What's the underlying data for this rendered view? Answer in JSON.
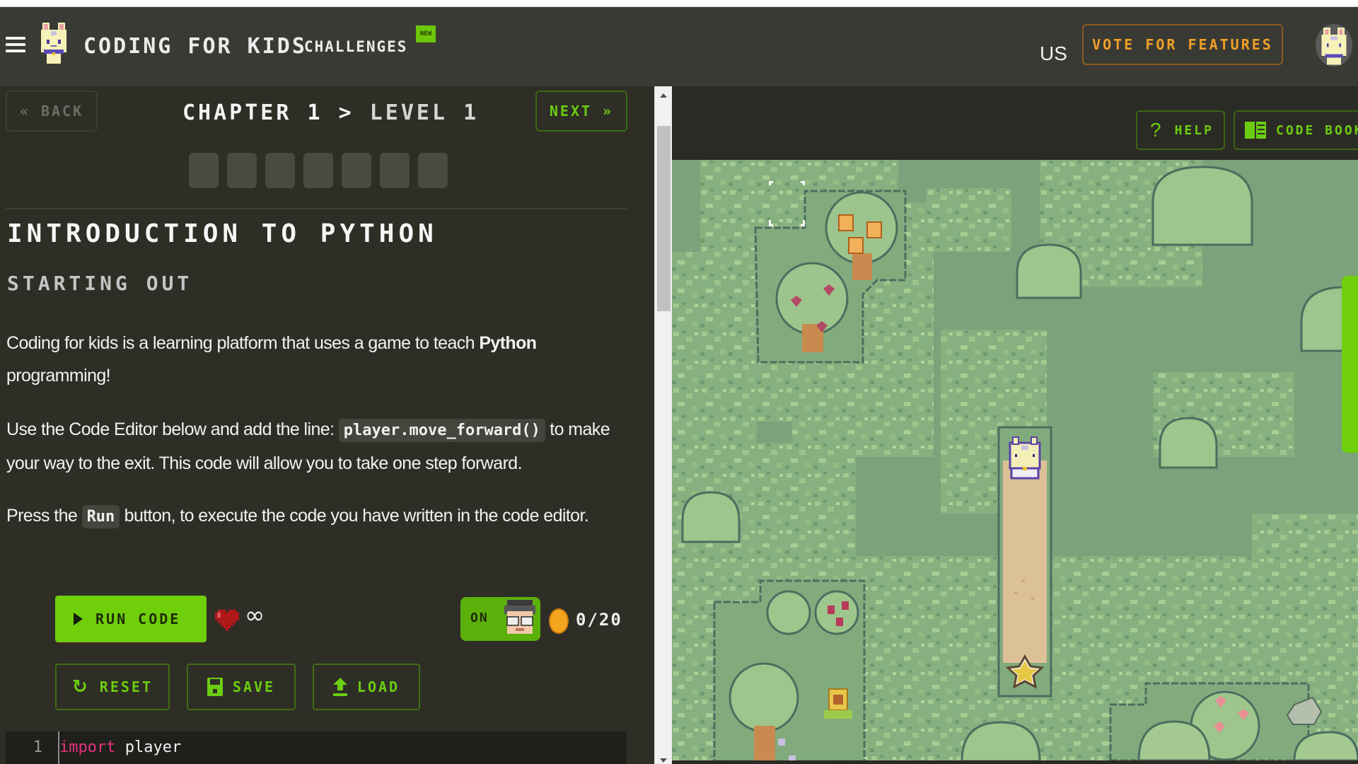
{
  "header": {
    "brand": "CODING FOR KIDS",
    "challenges_label": "CHALLENGES",
    "new_badge": "NEW",
    "locale": "US",
    "vote_label": "VOTE FOR FEATURES"
  },
  "lesson_nav": {
    "back_label": "« BACK",
    "chapter": "CHAPTER 1",
    "separator": ">",
    "level": "LEVEL 1",
    "next_label": "NEXT »",
    "progress_steps": 7,
    "progress_completed": 0
  },
  "lesson": {
    "title": "INTRODUCTION TO PYTHON",
    "subtitle": "STARTING OUT",
    "p1_text": "Coding for kids is a learning platform that uses a game to teach ",
    "p1_bold": "Python",
    "p1_end": " programming!",
    "p2_text": "Use the Code Editor below and add the line: ",
    "p2_code": "player.move_forward()",
    "p2_end": " to make your way to the exit. This code will allow you to take one step forward.",
    "p3_text": "Press the ",
    "p3_code": "Run",
    "p3_end": " button, to execute the code you have written in the code editor."
  },
  "controls": {
    "run_label": "RUN CODE",
    "lives": "∞",
    "toggle_label": "ON",
    "coins": "0/20",
    "reset_label": "RESET",
    "save_label": "SAVE",
    "load_label": "LOAD"
  },
  "editor": {
    "lines": [
      {
        "number": "1",
        "keyword": "import",
        "rest": " player"
      }
    ]
  },
  "game_toolbar": {
    "help_label": "HELP",
    "codebook_label": "CODE BOOK"
  },
  "colors": {
    "accent_green": "#6fcf0b",
    "vote_orange": "#f0a028",
    "panel_bg": "#2e2e27",
    "header_bg": "#3a3a34",
    "grass": "#7ba27b",
    "keyword_pink": "#e5337a"
  }
}
